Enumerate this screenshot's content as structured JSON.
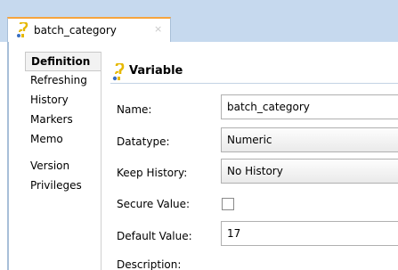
{
  "editor_tab": {
    "title": "batch_category",
    "icon": "variable-icon",
    "close_icon": "close-icon",
    "close_glyph": "×"
  },
  "nav": {
    "items": [
      {
        "label": "Definition",
        "active": true
      },
      {
        "label": "Refreshing"
      },
      {
        "label": "History"
      },
      {
        "label": "Markers"
      },
      {
        "label": "Memo"
      },
      {
        "label": "Version"
      },
      {
        "label": "Privileges"
      }
    ]
  },
  "section": {
    "title": "Variable",
    "icon": "variable-icon"
  },
  "form": {
    "name_label": "Name:",
    "name_value": "batch_category",
    "datatype_label": "Datatype:",
    "datatype_value": "Numeric",
    "keep_history_label": "Keep History:",
    "keep_history_value": "No History",
    "secure_value_label": "Secure Value:",
    "secure_value_checked": false,
    "default_value_label": "Default Value:",
    "default_value": "17",
    "description_label": "Description:"
  },
  "colors": {
    "tab_strip": "#c6d9ee",
    "tab_accent": "#f7a53d",
    "icon_body": "#e6b800"
  }
}
